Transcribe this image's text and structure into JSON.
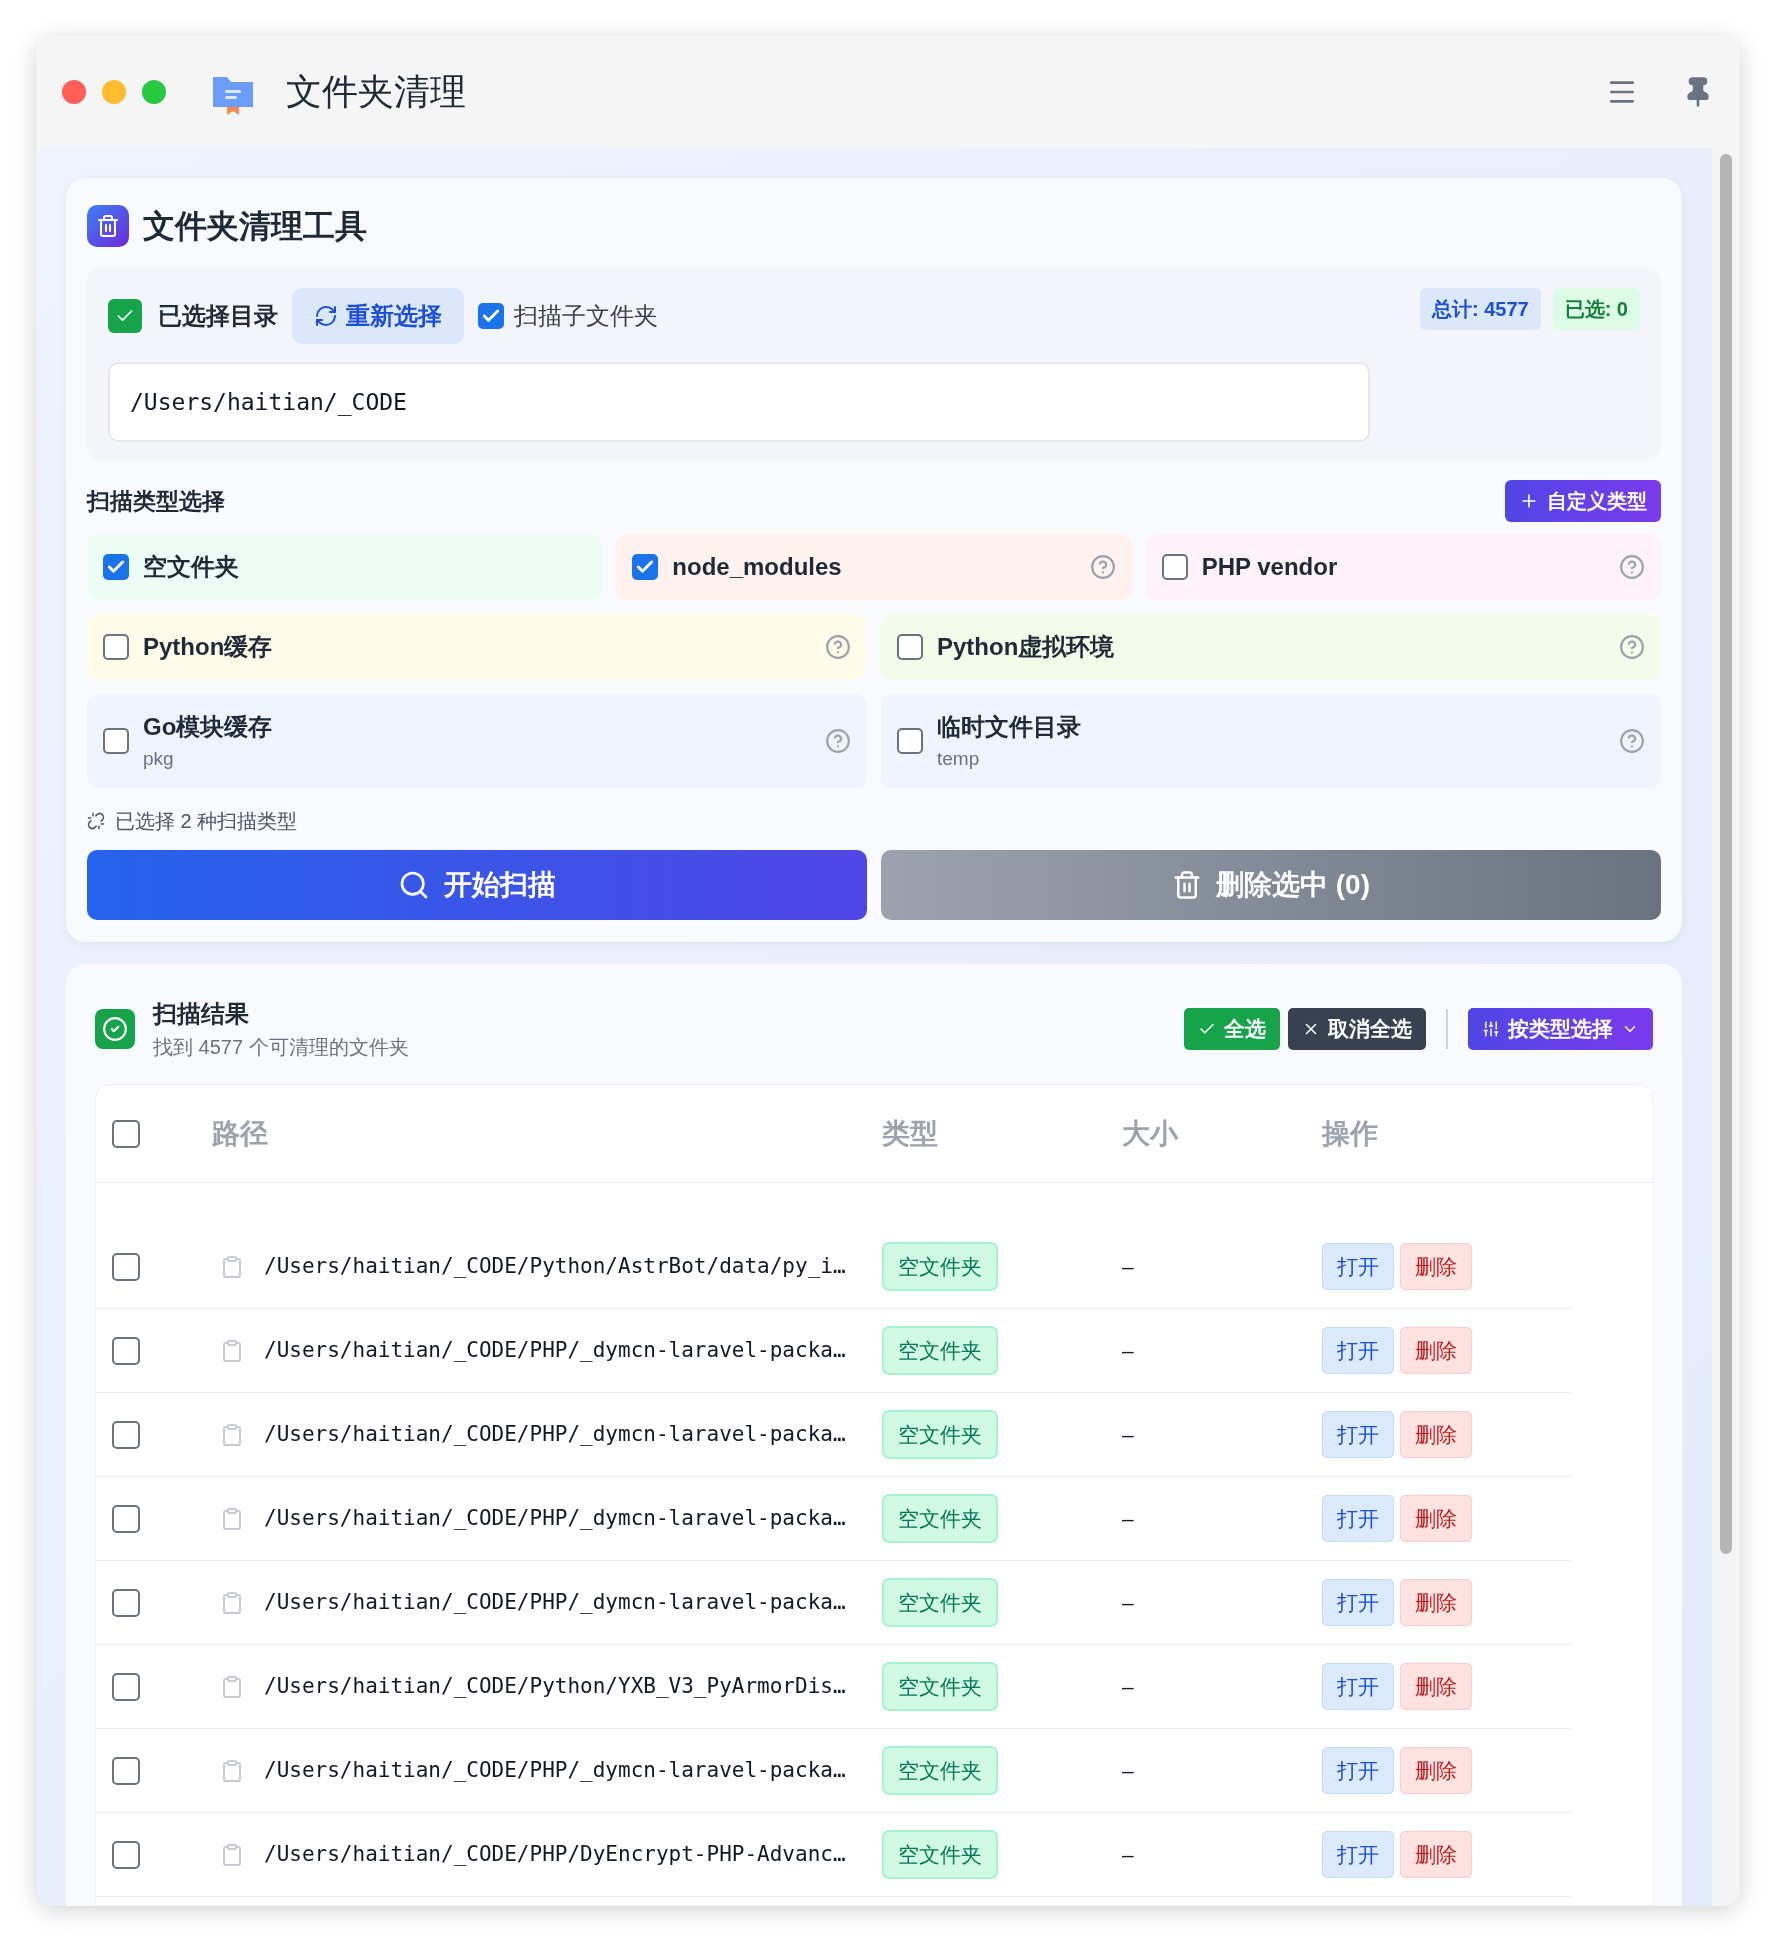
{
  "window": {
    "title": "文件夹清理"
  },
  "tool": {
    "title": "文件夹清理工具",
    "dir_label": "已选择目录",
    "reselect": "重新选择",
    "subfolders": {
      "label": "扫描子文件夹",
      "checked": true
    },
    "total": "总计: 4577",
    "selected_count": "已选: 0",
    "path": "/Users/haitian/_CODE"
  },
  "scan_types": {
    "title": "扫描类型选择",
    "custom_button": "自定义类型",
    "summary": "已选择 2 种扫描类型",
    "items": [
      {
        "label": "空文件夹",
        "checked": true,
        "help": false,
        "color": "#ecfdf5"
      },
      {
        "label": "node_modules",
        "checked": true,
        "help": true,
        "color": "#fff1ee"
      },
      {
        "label": "PHP vendor",
        "checked": false,
        "help": true,
        "color": "#fdf2f8"
      },
      {
        "label": "Python缓存",
        "checked": false,
        "help": true,
        "color": "#fefbe8"
      },
      {
        "label": "Python虚拟环境",
        "checked": false,
        "help": true,
        "color": "#f3fce8"
      },
      {
        "label": "Go模块缓存",
        "sub": "pkg",
        "checked": false,
        "help": true,
        "color": "#eff4fe"
      },
      {
        "label": "临时文件目录",
        "sub": "temp",
        "checked": false,
        "help": true,
        "color": "#eff4fe"
      }
    ]
  },
  "actions": {
    "scan": "开始扫描",
    "delete": "删除选中 (0)"
  },
  "results": {
    "title": "扫描结果",
    "subtitle": "找到 4577 个可清理的文件夹",
    "select_all": "全选",
    "deselect_all": "取消全选",
    "by_type": "按类型选择",
    "header_checked": false,
    "columns": [
      "路径",
      "类型",
      "大小",
      "操作"
    ],
    "rows": [
      {
        "path": "/Users/haitian/_CODE/Python/AstrBot/data/py_i…",
        "type": "空文件夹",
        "size": "–",
        "open": "打开",
        "delete": "删除",
        "checked": false
      },
      {
        "path": "/Users/haitian/_CODE/PHP/_dymcn-laravel-packa…",
        "type": "空文件夹",
        "size": "–",
        "open": "打开",
        "delete": "删除",
        "checked": false
      },
      {
        "path": "/Users/haitian/_CODE/PHP/_dymcn-laravel-packa…",
        "type": "空文件夹",
        "size": "–",
        "open": "打开",
        "delete": "删除",
        "checked": false
      },
      {
        "path": "/Users/haitian/_CODE/PHP/_dymcn-laravel-packa…",
        "type": "空文件夹",
        "size": "–",
        "open": "打开",
        "delete": "删除",
        "checked": false
      },
      {
        "path": "/Users/haitian/_CODE/PHP/_dymcn-laravel-packa…",
        "type": "空文件夹",
        "size": "–",
        "open": "打开",
        "delete": "删除",
        "checked": false
      },
      {
        "path": "/Users/haitian/_CODE/Python/YXB_V3_PyArmorDis…",
        "type": "空文件夹",
        "size": "–",
        "open": "打开",
        "delete": "删除",
        "checked": false
      },
      {
        "path": "/Users/haitian/_CODE/PHP/_dymcn-laravel-packa…",
        "type": "空文件夹",
        "size": "–",
        "open": "打开",
        "delete": "删除",
        "checked": false
      },
      {
        "path": "/Users/haitian/_CODE/PHP/DyEncrypt-PHP-Advanc…",
        "type": "空文件夹",
        "size": "–",
        "open": "打开",
        "delete": "删除",
        "checked": false
      }
    ]
  }
}
